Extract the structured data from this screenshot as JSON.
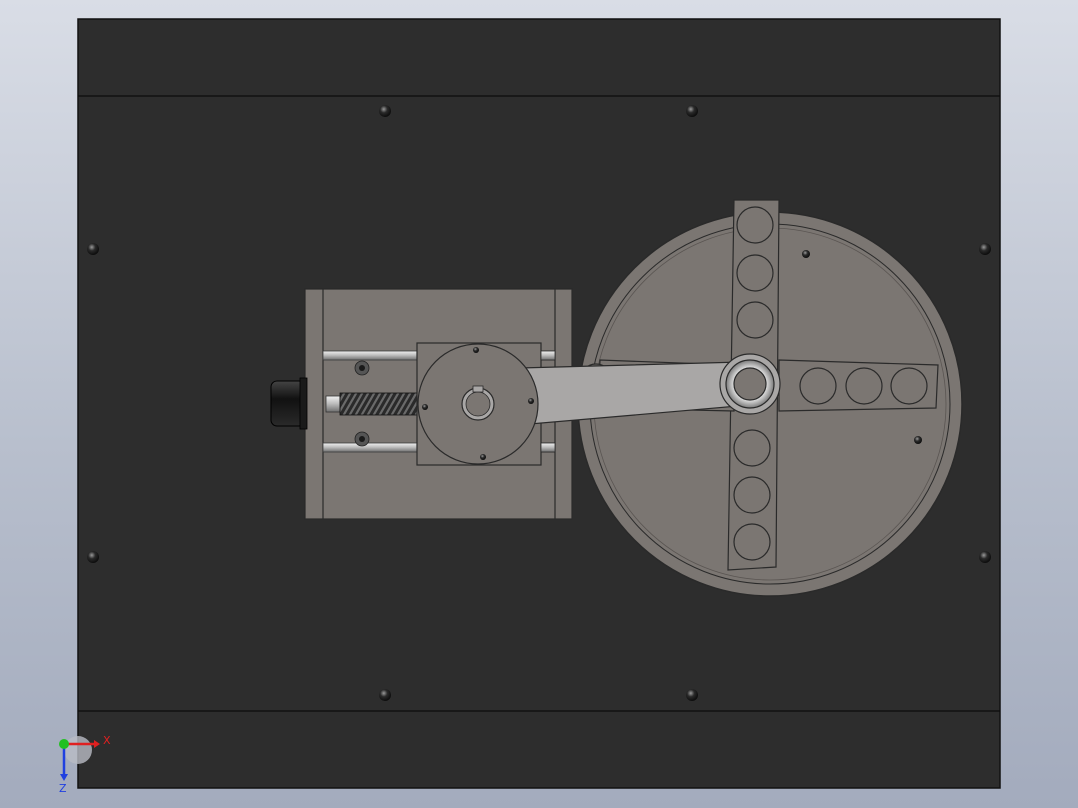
{
  "viewport": {
    "background_top": "#d9dde6",
    "background_bottom": "#a3abbd"
  },
  "model": {
    "plate_color": "#2d2d2d",
    "edge_color": "#111111",
    "part_color": "#7b7672",
    "light_part_color": "#a9a7a6",
    "screw_color": "#1c1c1c"
  },
  "triad": {
    "x_label": "X",
    "z_label": "Z",
    "x_color": "#e02020",
    "y_color": "#20c020",
    "z_color": "#2040e0"
  }
}
